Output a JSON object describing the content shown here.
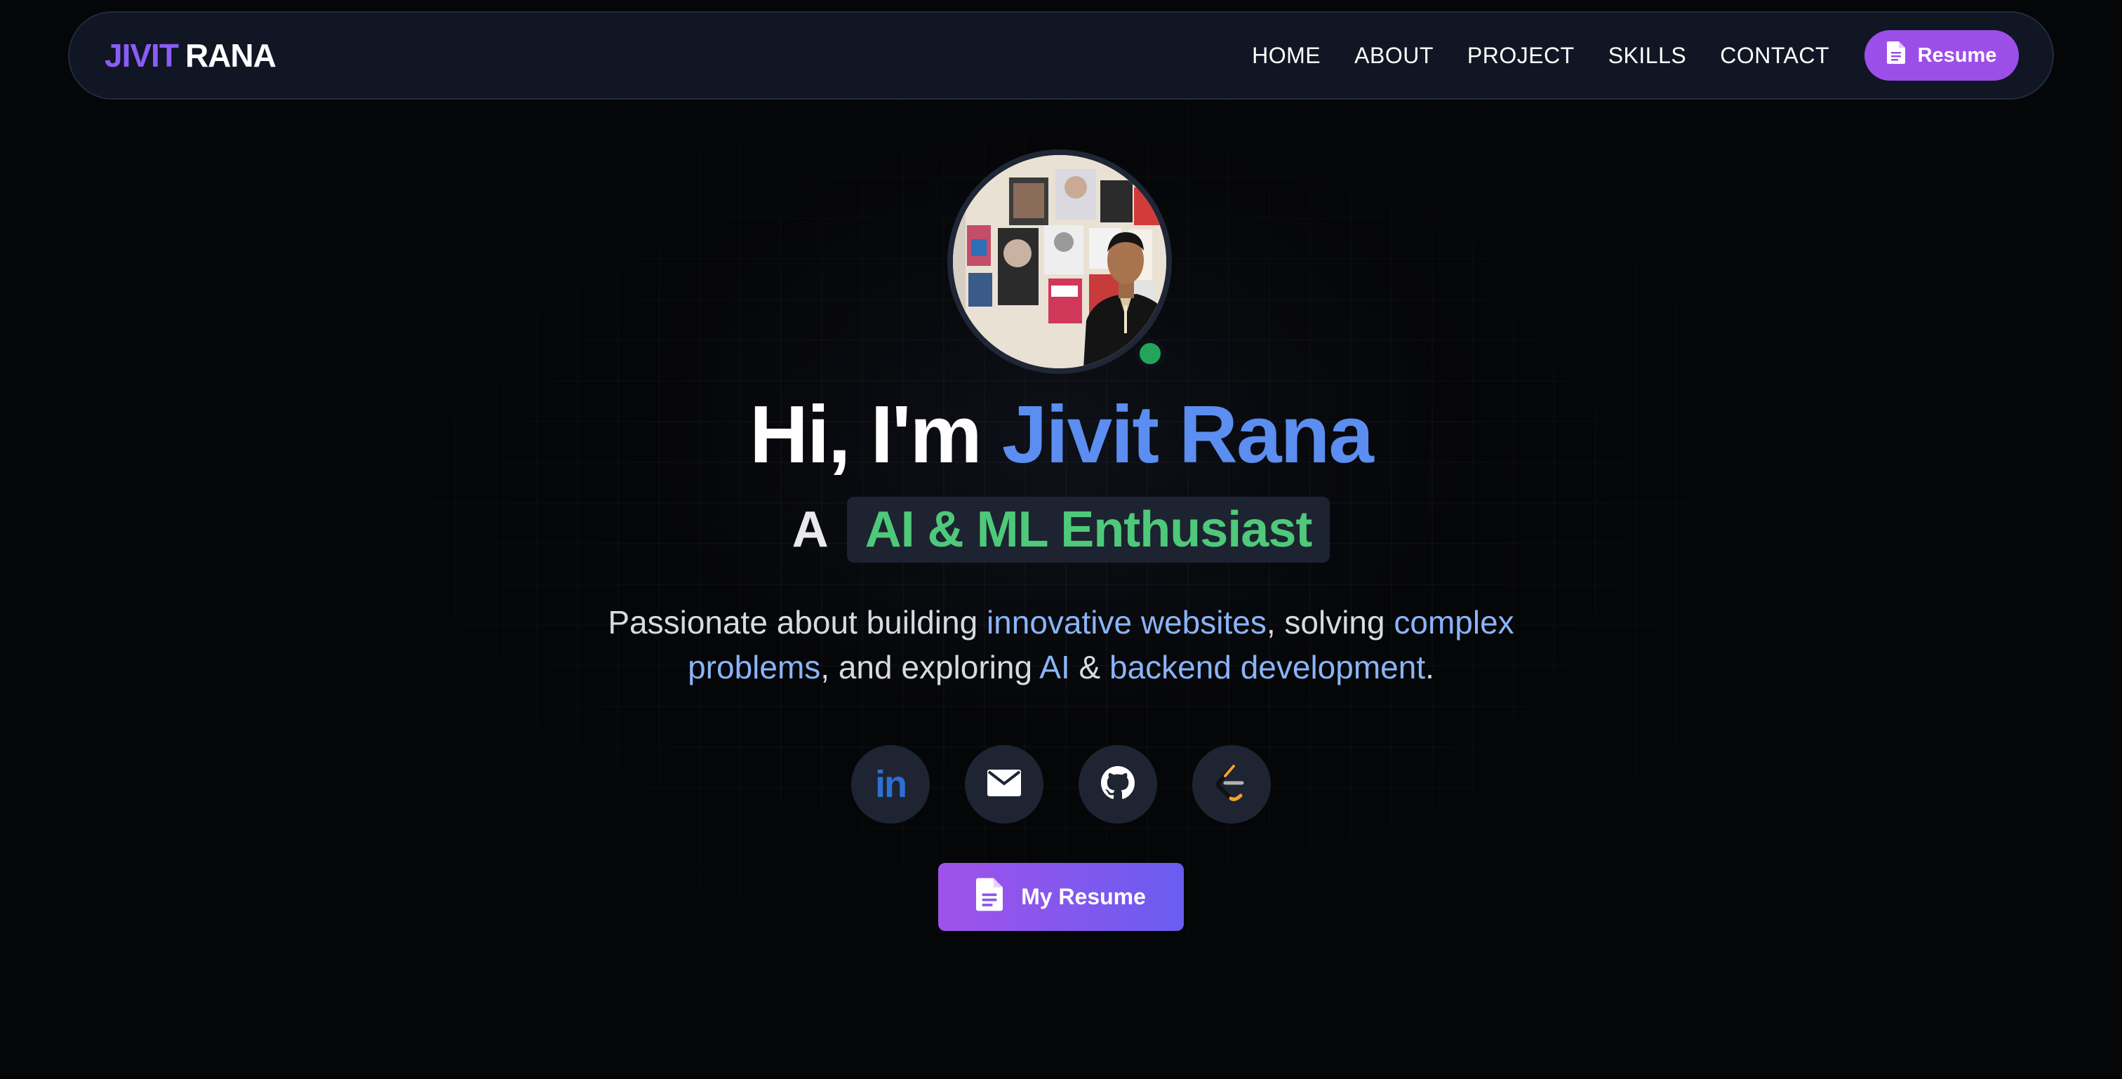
{
  "navbar": {
    "logo_first": "JIVIT",
    "logo_second": "RANA",
    "links": [
      "HOME",
      "ABOUT",
      "PROJECT",
      "SKILLS",
      "CONTACT"
    ],
    "resume_label": "Resume"
  },
  "hero": {
    "greeting": "Hi, I'm",
    "name": "Jivit Rana",
    "role_prefix": "A",
    "role": "AI & ML Enthusiast",
    "tagline": {
      "t1": "Passionate about building ",
      "h1": "innovative websites",
      "t2": ", solving ",
      "h2": "complex",
      "h3": "problems",
      "t3": ", and exploring ",
      "h4": "AI",
      "t4": " & ",
      "h5": "backend development",
      "t5": "."
    },
    "socials": {
      "linkedin_text": "in",
      "icons": [
        "linkedin-icon",
        "email-icon",
        "github-icon",
        "leetcode-icon"
      ]
    },
    "cta_label": "My Resume",
    "status": "online"
  },
  "colors": {
    "accent_purple": "#8b5cf6",
    "name_blue": "#5b8ef0",
    "role_green": "#4ec97a",
    "highlight_blue": "#8ab4f8",
    "status_green": "#22a55a"
  }
}
